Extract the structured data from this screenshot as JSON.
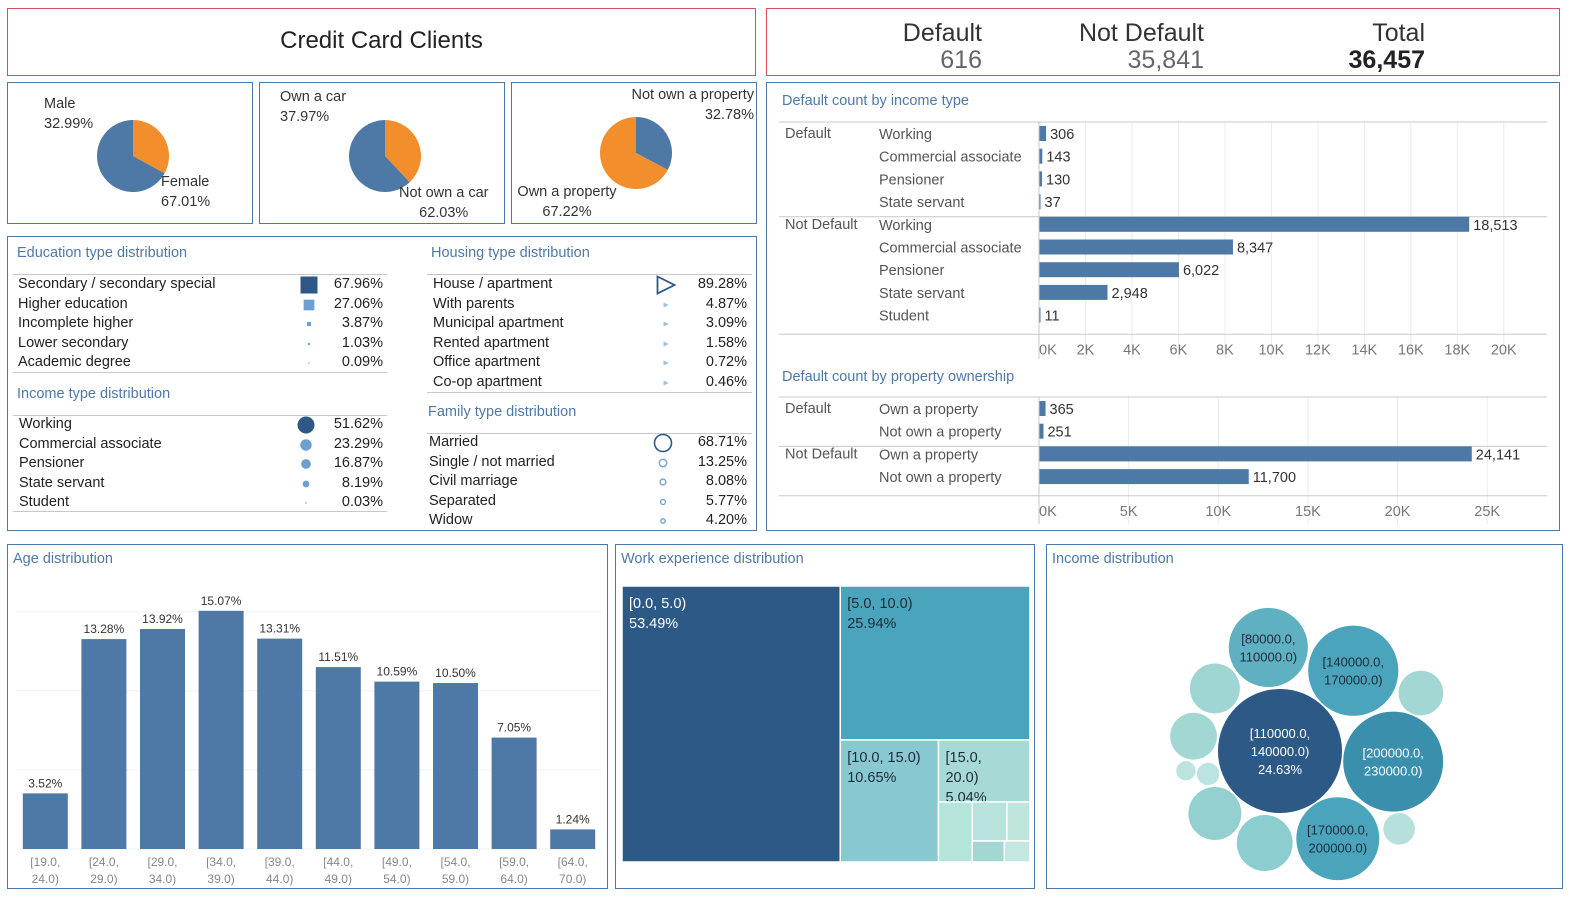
{
  "header": {
    "title": "Credit Card Clients",
    "kpis": [
      {
        "label": "Default",
        "value": "616"
      },
      {
        "label": "Not Default",
        "value": "35,841"
      },
      {
        "label": "Total",
        "value": "36,457"
      }
    ]
  },
  "pies": [
    {
      "slices": [
        {
          "label": "Male",
          "pct": "32.99%",
          "value": 32.99,
          "color": "#f28e2b"
        },
        {
          "label": "Female",
          "pct": "67.01%",
          "value": 67.01,
          "color": "#4e79a7"
        }
      ]
    },
    {
      "slices": [
        {
          "label": "Own a car",
          "pct": "37.97%",
          "value": 37.97,
          "color": "#f28e2b"
        },
        {
          "label": "Not own a car",
          "pct": "62.03%",
          "value": 62.03,
          "color": "#4e79a7"
        }
      ]
    },
    {
      "slices": [
        {
          "label": "Not own a property",
          "pct": "32.78%",
          "value": 32.78,
          "color": "#4e79a7"
        },
        {
          "label": "Own a property",
          "pct": "67.22%",
          "value": 67.22,
          "color": "#f28e2b"
        }
      ]
    }
  ],
  "distributions": {
    "education": {
      "title": "Education type distribution",
      "rows": [
        {
          "label": "Secondary / secondary special",
          "pct": "67.96%",
          "value": 67.96
        },
        {
          "label": "Higher education",
          "pct": "27.06%",
          "value": 27.06
        },
        {
          "label": "Incomplete higher",
          "pct": "3.87%",
          "value": 3.87
        },
        {
          "label": "Lower secondary",
          "pct": "1.03%",
          "value": 1.03
        },
        {
          "label": "Academic degree",
          "pct": "0.09%",
          "value": 0.09
        }
      ]
    },
    "income": {
      "title": "Income type distribution",
      "rows": [
        {
          "label": "Working",
          "pct": "51.62%",
          "value": 51.62
        },
        {
          "label": "Commercial associate",
          "pct": "23.29%",
          "value": 23.29
        },
        {
          "label": "Pensioner",
          "pct": "16.87%",
          "value": 16.87
        },
        {
          "label": "State servant",
          "pct": "8.19%",
          "value": 8.19
        },
        {
          "label": "Student",
          "pct": "0.03%",
          "value": 0.03
        }
      ]
    },
    "housing": {
      "title": "Housing type distribution",
      "rows": [
        {
          "label": "House / apartment",
          "pct": "89.28%",
          "value": 89.28
        },
        {
          "label": "With parents",
          "pct": "4.87%",
          "value": 4.87
        },
        {
          "label": "Municipal apartment",
          "pct": "3.09%",
          "value": 3.09
        },
        {
          "label": "Rented apartment",
          "pct": "1.58%",
          "value": 1.58
        },
        {
          "label": "Office apartment",
          "pct": "0.72%",
          "value": 0.72
        },
        {
          "label": "Co-op apartment",
          "pct": "0.46%",
          "value": 0.46
        }
      ]
    },
    "family": {
      "title": "Family type distribution",
      "rows": [
        {
          "label": "Married",
          "pct": "68.71%",
          "value": 68.71
        },
        {
          "label": "Single / not married",
          "pct": "13.25%",
          "value": 13.25
        },
        {
          "label": "Civil marriage",
          "pct": "8.08%",
          "value": 8.08
        },
        {
          "label": "Separated",
          "pct": "5.77%",
          "value": 5.77
        },
        {
          "label": "Widow",
          "pct": "4.20%",
          "value": 4.2
        }
      ]
    }
  },
  "chart_data": [
    {
      "type": "bar",
      "orientation": "horizontal",
      "title": "Default count by income type",
      "groups": [
        {
          "name": "Default",
          "categories": [
            "Working",
            "Commercial associate",
            "Pensioner",
            "State servant"
          ],
          "values": [
            306,
            143,
            130,
            37
          ],
          "labels": [
            "306",
            "143",
            "130",
            "37"
          ]
        },
        {
          "name": "Not Default",
          "categories": [
            "Working",
            "Commercial associate",
            "Pensioner",
            "State servant",
            "Student"
          ],
          "values": [
            18513,
            8347,
            6022,
            2948,
            11
          ],
          "labels": [
            "18,513",
            "8,347",
            "6,022",
            "2,948",
            "11"
          ]
        }
      ],
      "xlim": [
        0,
        21000
      ],
      "xticks": [
        0,
        2000,
        4000,
        6000,
        8000,
        10000,
        12000,
        14000,
        16000,
        18000,
        20000
      ],
      "xticklabels": [
        "0K",
        "2K",
        "4K",
        "6K",
        "8K",
        "10K",
        "12K",
        "14K",
        "16K",
        "18K",
        "20K"
      ],
      "grid": true,
      "color": "#4e79a7"
    },
    {
      "type": "bar",
      "orientation": "horizontal",
      "title": "Default count by property ownership",
      "groups": [
        {
          "name": "Default",
          "categories": [
            "Own a property",
            "Not own a property"
          ],
          "values": [
            365,
            251
          ],
          "labels": [
            "365",
            "251"
          ]
        },
        {
          "name": "Not Default",
          "categories": [
            "Own a property",
            "Not own a property"
          ],
          "values": [
            24141,
            11700
          ],
          "labels": [
            "24,141",
            "11,700"
          ]
        }
      ],
      "xlim": [
        0,
        27500
      ],
      "xticks": [
        0,
        5000,
        10000,
        15000,
        20000,
        25000
      ],
      "xticklabels": [
        "0K",
        "5K",
        "10K",
        "15K",
        "20K",
        "25K"
      ],
      "grid": true,
      "color": "#4e79a7"
    },
    {
      "type": "bar",
      "title": "Age distribution",
      "categories": [
        [
          "[19.0,",
          "24.0)"
        ],
        [
          "[24.0,",
          "29.0)"
        ],
        [
          "[29.0,",
          "34.0)"
        ],
        [
          "[34.0,",
          "39.0)"
        ],
        [
          "[39.0,",
          "44.0)"
        ],
        [
          "[44.0,",
          "49.0)"
        ],
        [
          "[49.0,",
          "54.0)"
        ],
        [
          "[54.0,",
          "59.0)"
        ],
        [
          "[59.0,",
          "64.0)"
        ],
        [
          "[64.0,",
          "70.0)"
        ]
      ],
      "values": [
        3.52,
        13.28,
        13.92,
        15.07,
        13.31,
        11.51,
        10.59,
        10.5,
        7.05,
        1.24
      ],
      "labels": [
        "3.52%",
        "13.28%",
        "13.92%",
        "15.07%",
        "13.31%",
        "11.51%",
        "10.59%",
        "10.50%",
        "7.05%",
        "1.24%"
      ],
      "ylim": [
        0,
        15.5
      ],
      "grid": true,
      "color": "#4e79a7"
    },
    {
      "type": "treemap",
      "title": "Work experience distribution",
      "items": [
        {
          "label": [
            "[0.0, 5.0)",
            "53.49%"
          ],
          "value": 53.49,
          "color": "#2c5985",
          "text_color": "#ffffff"
        },
        {
          "label": [
            "[5.0, 10.0)",
            "25.94%"
          ],
          "value": 25.94,
          "color": "#4aa4bb",
          "text_color": "#1e2b3a"
        },
        {
          "label": [
            "[10.0, 15.0)",
            "10.65%"
          ],
          "value": 10.65,
          "color": "#87c8d1",
          "text_color": "#1e2b3a"
        },
        {
          "label": [
            "[15.0,",
            "20.0)",
            "5.04%"
          ],
          "value": 5.04,
          "color": "#a7dad6",
          "text_color": "#1e2b3a"
        },
        {
          "label": [],
          "value": 1.8,
          "color": "#b5e4da"
        },
        {
          "label": [],
          "value": 1.2,
          "color": "#b8e3dc"
        },
        {
          "label": [],
          "value": 0.8,
          "color": "#bfe6dd"
        },
        {
          "label": [],
          "value": 0.6,
          "color": "#a3d8d2"
        },
        {
          "label": [],
          "value": 0.48,
          "color": "#c4e8e1"
        }
      ]
    },
    {
      "type": "bubble",
      "title": "Income distribution",
      "bubbles": [
        {
          "label": [
            "[110000.0,",
            "140000.0)",
            "24.63%"
          ],
          "value": 24.63,
          "color": "#2c5985",
          "text_color": "#ffffff"
        },
        {
          "label": [
            "[200000.0,",
            "230000.0)"
          ],
          "value": 16.0,
          "color": "#3a8fad",
          "text_color": "#ffffff"
        },
        {
          "label": [
            "[140000.0,",
            "170000.0)"
          ],
          "value": 13.0,
          "color": "#4aa4bb",
          "text_color": "#1e2b3a"
        },
        {
          "label": [
            "[170000.0,",
            "200000.0)"
          ],
          "value": 11.0,
          "color": "#4aa4bb",
          "text_color": "#1e2b3a"
        },
        {
          "label": [
            "[80000.0,",
            "110000.0)"
          ],
          "value": 10.0,
          "color": "#5fb0c0",
          "text_color": "#1e2b3a"
        },
        {
          "label": [],
          "value": 5.0,
          "color": "#8ccdd0"
        },
        {
          "label": [],
          "value": 4.5,
          "color": "#94d0cf"
        },
        {
          "label": [],
          "value": 4.0,
          "color": "#9fd6d3"
        },
        {
          "label": [],
          "value": 3.5,
          "color": "#a3d7d4"
        },
        {
          "label": [],
          "value": 3.2,
          "color": "#a3d7d4"
        },
        {
          "label": [],
          "value": 1.6,
          "color": "#b5e0dc"
        },
        {
          "label": [],
          "value": 0.8,
          "color": "#bce4df"
        },
        {
          "label": [],
          "value": 0.6,
          "color": "#bce4df"
        }
      ]
    }
  ]
}
